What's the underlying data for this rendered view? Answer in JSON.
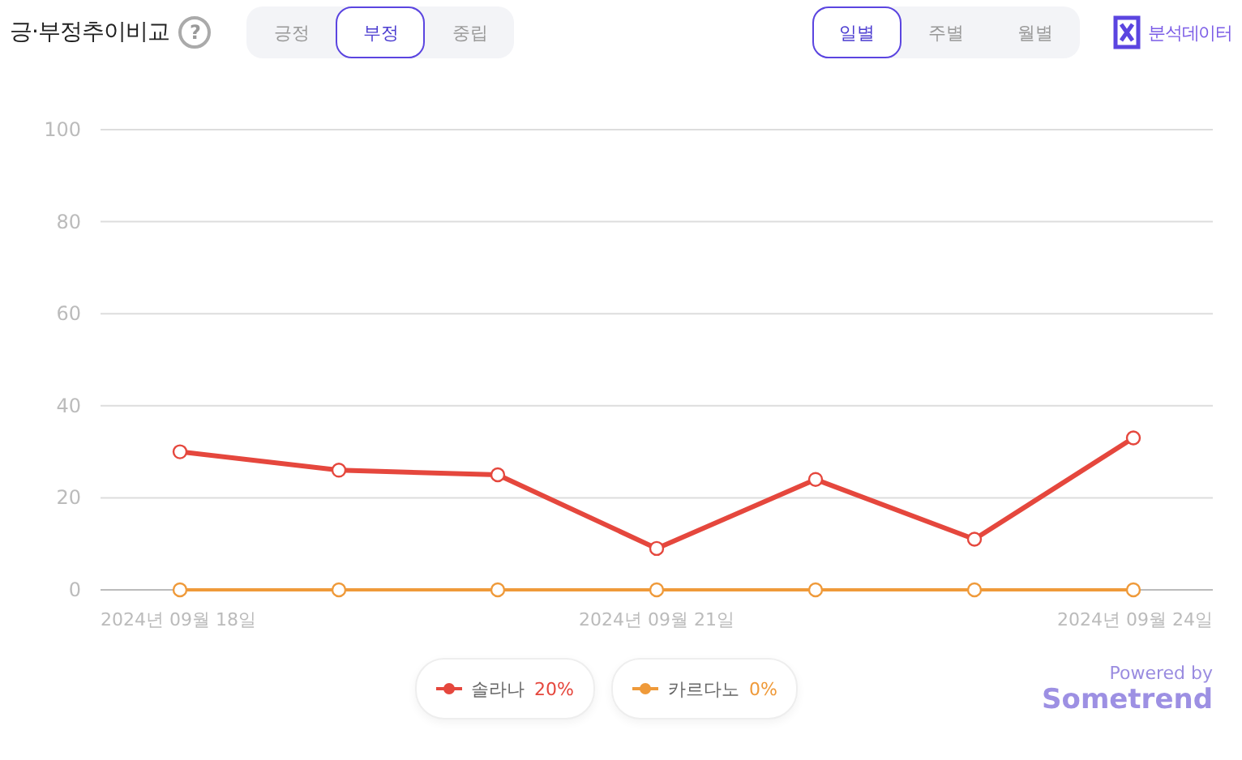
{
  "header": {
    "title": "긍·부정추이비교",
    "help": "?",
    "sentiment_tabs": [
      {
        "label": "긍정",
        "selected": false
      },
      {
        "label": "부정",
        "selected": true
      },
      {
        "label": "중립",
        "selected": false
      }
    ],
    "period_tabs": [
      {
        "label": "일별",
        "selected": true
      },
      {
        "label": "주별",
        "selected": false
      },
      {
        "label": "월별",
        "selected": false
      }
    ],
    "export_label": "분석데이터"
  },
  "chart": {
    "chart_data": {
      "type": "line",
      "categories": [
        "2024년 09월 18일",
        null,
        null,
        "2024년 09월 21일",
        null,
        null,
        "2024년 09월 24일"
      ],
      "ylim": [
        0,
        100
      ],
      "grid": true,
      "yticks": [
        0,
        20,
        40,
        60,
        80,
        100
      ],
      "series": [
        {
          "name": "솔라나",
          "color": "#e5473d",
          "marker": "circle",
          "values": [
            30,
            26,
            25,
            9,
            24,
            11,
            33
          ]
        },
        {
          "name": "카르다노",
          "color": "#ef9a3a",
          "marker": "circle",
          "values": [
            0,
            0,
            0,
            0,
            0,
            0,
            0
          ]
        }
      ]
    },
    "legend_values": [
      "20%",
      "0%"
    ]
  },
  "powered_by": {
    "caption": "Powered by",
    "brand": "Sometrend"
  }
}
